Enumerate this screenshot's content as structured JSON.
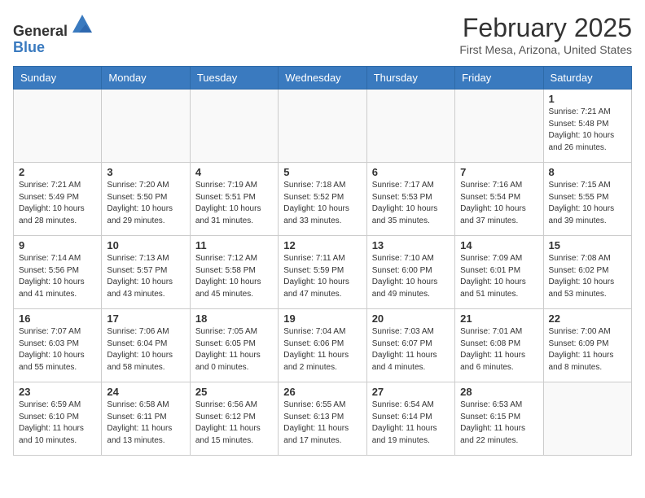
{
  "header": {
    "logo_general": "General",
    "logo_blue": "Blue",
    "month_title": "February 2025",
    "location": "First Mesa, Arizona, United States"
  },
  "days_of_week": [
    "Sunday",
    "Monday",
    "Tuesday",
    "Wednesday",
    "Thursday",
    "Friday",
    "Saturday"
  ],
  "weeks": [
    [
      {
        "day": "",
        "info": ""
      },
      {
        "day": "",
        "info": ""
      },
      {
        "day": "",
        "info": ""
      },
      {
        "day": "",
        "info": ""
      },
      {
        "day": "",
        "info": ""
      },
      {
        "day": "",
        "info": ""
      },
      {
        "day": "1",
        "info": "Sunrise: 7:21 AM\nSunset: 5:48 PM\nDaylight: 10 hours and 26 minutes."
      }
    ],
    [
      {
        "day": "2",
        "info": "Sunrise: 7:21 AM\nSunset: 5:49 PM\nDaylight: 10 hours and 28 minutes."
      },
      {
        "day": "3",
        "info": "Sunrise: 7:20 AM\nSunset: 5:50 PM\nDaylight: 10 hours and 29 minutes."
      },
      {
        "day": "4",
        "info": "Sunrise: 7:19 AM\nSunset: 5:51 PM\nDaylight: 10 hours and 31 minutes."
      },
      {
        "day": "5",
        "info": "Sunrise: 7:18 AM\nSunset: 5:52 PM\nDaylight: 10 hours and 33 minutes."
      },
      {
        "day": "6",
        "info": "Sunrise: 7:17 AM\nSunset: 5:53 PM\nDaylight: 10 hours and 35 minutes."
      },
      {
        "day": "7",
        "info": "Sunrise: 7:16 AM\nSunset: 5:54 PM\nDaylight: 10 hours and 37 minutes."
      },
      {
        "day": "8",
        "info": "Sunrise: 7:15 AM\nSunset: 5:55 PM\nDaylight: 10 hours and 39 minutes."
      }
    ],
    [
      {
        "day": "9",
        "info": "Sunrise: 7:14 AM\nSunset: 5:56 PM\nDaylight: 10 hours and 41 minutes."
      },
      {
        "day": "10",
        "info": "Sunrise: 7:13 AM\nSunset: 5:57 PM\nDaylight: 10 hours and 43 minutes."
      },
      {
        "day": "11",
        "info": "Sunrise: 7:12 AM\nSunset: 5:58 PM\nDaylight: 10 hours and 45 minutes."
      },
      {
        "day": "12",
        "info": "Sunrise: 7:11 AM\nSunset: 5:59 PM\nDaylight: 10 hours and 47 minutes."
      },
      {
        "day": "13",
        "info": "Sunrise: 7:10 AM\nSunset: 6:00 PM\nDaylight: 10 hours and 49 minutes."
      },
      {
        "day": "14",
        "info": "Sunrise: 7:09 AM\nSunset: 6:01 PM\nDaylight: 10 hours and 51 minutes."
      },
      {
        "day": "15",
        "info": "Sunrise: 7:08 AM\nSunset: 6:02 PM\nDaylight: 10 hours and 53 minutes."
      }
    ],
    [
      {
        "day": "16",
        "info": "Sunrise: 7:07 AM\nSunset: 6:03 PM\nDaylight: 10 hours and 55 minutes."
      },
      {
        "day": "17",
        "info": "Sunrise: 7:06 AM\nSunset: 6:04 PM\nDaylight: 10 hours and 58 minutes."
      },
      {
        "day": "18",
        "info": "Sunrise: 7:05 AM\nSunset: 6:05 PM\nDaylight: 11 hours and 0 minutes."
      },
      {
        "day": "19",
        "info": "Sunrise: 7:04 AM\nSunset: 6:06 PM\nDaylight: 11 hours and 2 minutes."
      },
      {
        "day": "20",
        "info": "Sunrise: 7:03 AM\nSunset: 6:07 PM\nDaylight: 11 hours and 4 minutes."
      },
      {
        "day": "21",
        "info": "Sunrise: 7:01 AM\nSunset: 6:08 PM\nDaylight: 11 hours and 6 minutes."
      },
      {
        "day": "22",
        "info": "Sunrise: 7:00 AM\nSunset: 6:09 PM\nDaylight: 11 hours and 8 minutes."
      }
    ],
    [
      {
        "day": "23",
        "info": "Sunrise: 6:59 AM\nSunset: 6:10 PM\nDaylight: 11 hours and 10 minutes."
      },
      {
        "day": "24",
        "info": "Sunrise: 6:58 AM\nSunset: 6:11 PM\nDaylight: 11 hours and 13 minutes."
      },
      {
        "day": "25",
        "info": "Sunrise: 6:56 AM\nSunset: 6:12 PM\nDaylight: 11 hours and 15 minutes."
      },
      {
        "day": "26",
        "info": "Sunrise: 6:55 AM\nSunset: 6:13 PM\nDaylight: 11 hours and 17 minutes."
      },
      {
        "day": "27",
        "info": "Sunrise: 6:54 AM\nSunset: 6:14 PM\nDaylight: 11 hours and 19 minutes."
      },
      {
        "day": "28",
        "info": "Sunrise: 6:53 AM\nSunset: 6:15 PM\nDaylight: 11 hours and 22 minutes."
      },
      {
        "day": "",
        "info": ""
      }
    ]
  ]
}
